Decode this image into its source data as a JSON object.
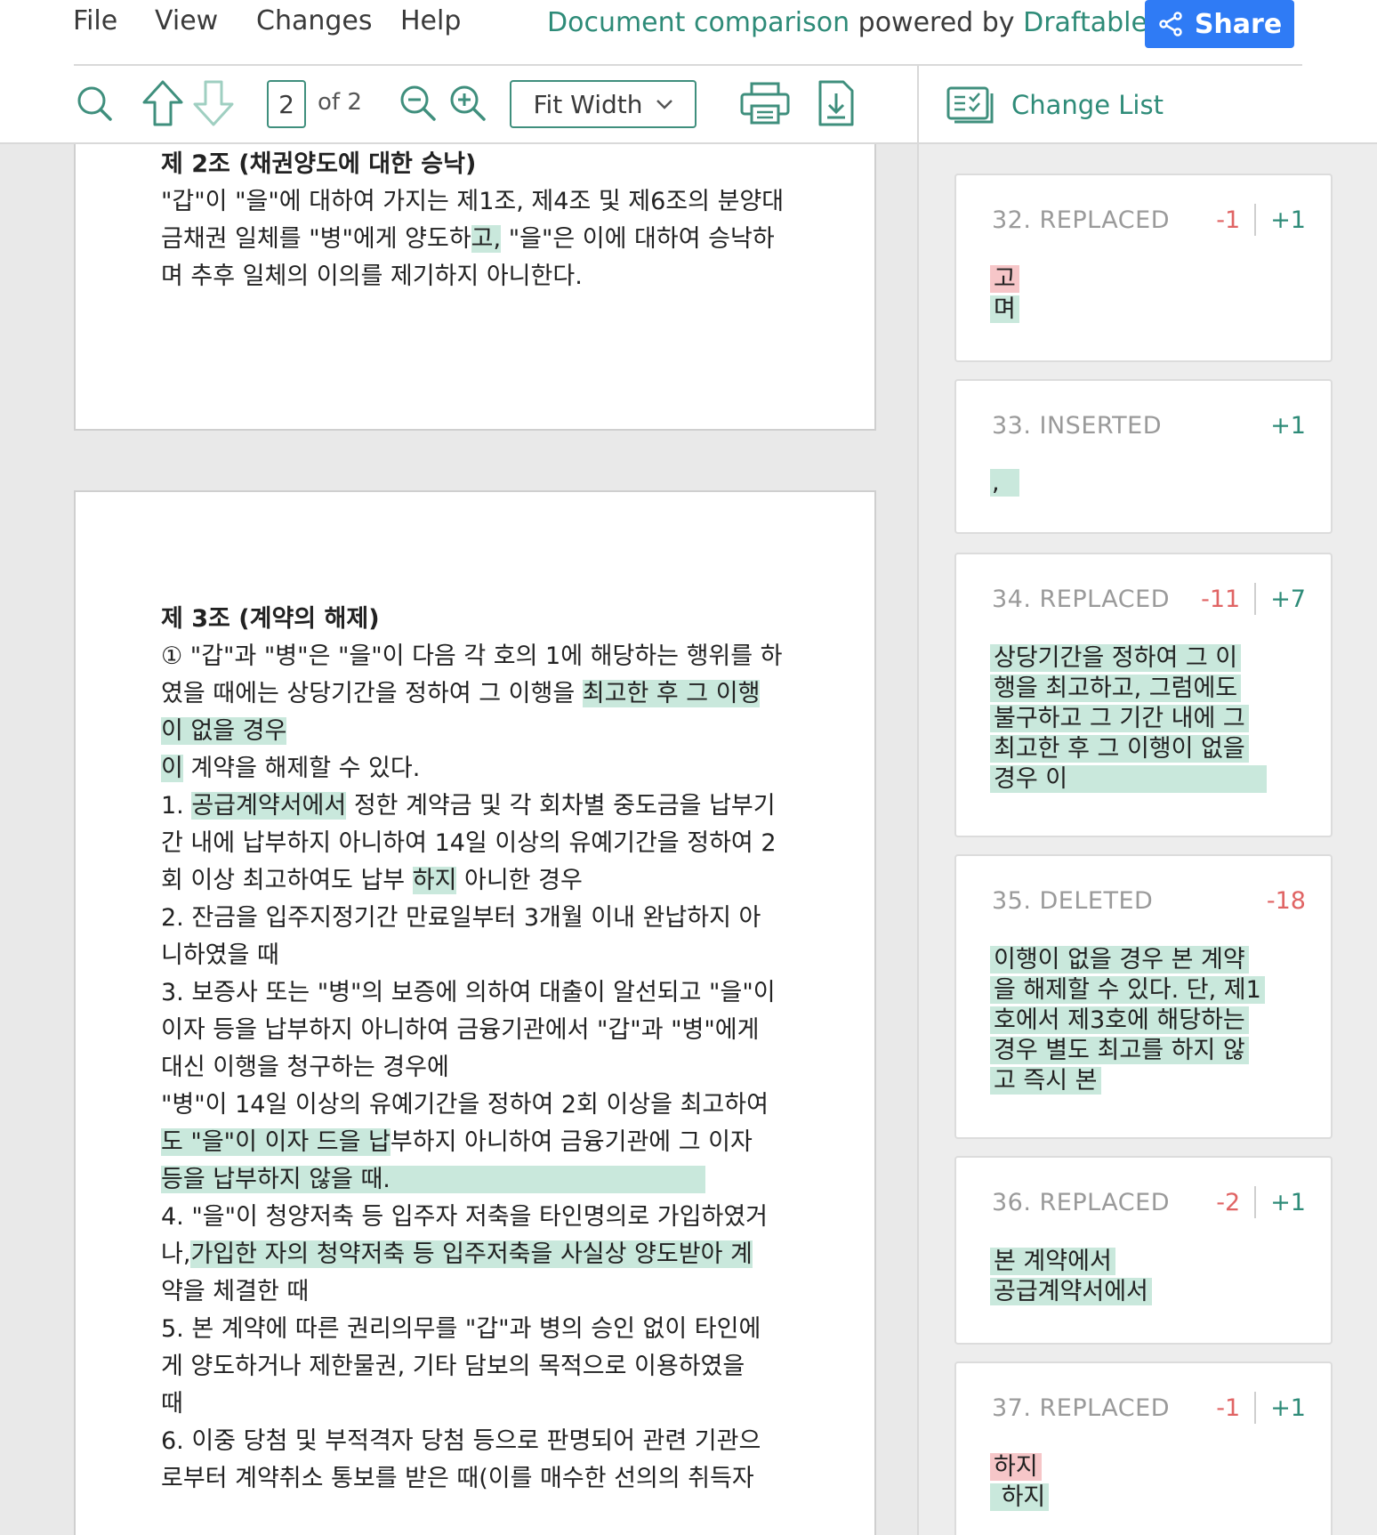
{
  "menu": {
    "items": [
      "File",
      "View",
      "Changes",
      "Help"
    ],
    "brand_prefix": "Document comparison",
    "brand_mid": " powered by ",
    "brand_name": "Draftable",
    "share_label": "Share"
  },
  "toolbar": {
    "current_page": "2",
    "of_pages": "of 2",
    "zoom_mode": "Fit Width"
  },
  "change_list": {
    "title": "Change List"
  },
  "doc": {
    "page1": {
      "heading": "제 2조 (채권양도에 대한 승낙)",
      "l1": "\"갑\"이 \"을\"에 대하여 가지는 제1조, 제4조 및 제6조의 분양대",
      "l2a": "금채권 일체를 \"병\"에게 양도하",
      "l2b": "고,",
      "l2c": " \"을\"은 이에 대하여 승낙하",
      "l3": "며 추후 일체의 이의를 제기하지 아니한다."
    },
    "page2": {
      "heading": "제 3조 (계약의 해제)",
      "l1": "① \"갑\"과 \"병\"은 \"을\"이 다음 각 호의 1에 해당하는 행위를 하",
      "l2a": "였을 때에는 상당기간을 정하여 그 이행을 ",
      "l2b": "최고한 후 그 이행",
      "l3": "이 없을 경우",
      "l4a": "이",
      "l4b": " 계약을 해제할 수 있다.",
      "l5a": "1. ",
      "l5b": "공급계약서에서",
      "l5c": " 정한 계약금 및 각 회차별 중도금을 납부기",
      "l6": "간 내에 납부하지 아니하여 14일 이상의 유예기간을 정하여 2",
      "l7a": "회 이상 최고하여도 납부 ",
      "l7b": "하지",
      "l7c": " 아니한 경우",
      "l8": "2. 잔금을 입주지정기간 만료일부터 3개월 이내 완납하지 아",
      "l9": "니하였을 때",
      "l10": "3. 보증사 또는 \"병\"의 보증에 의하여 대출이 알선되고 \"을\"이",
      "l11": "이자 등을 납부하지 아니하여 금융기관에서 \"갑\"과 \"병\"에게",
      "l12": "대신 이행을 청구하는 경우에",
      "l13": "\"병\"이 14일 이상의 유예기간을 정하여 2회 이상을 최고하여",
      "l14a": "도 \"을\"이 이자 드을 납",
      "l14b": "부하지 아니하여 금융기관에 그 이자",
      "l15": "등을 납부하지 않을 때.",
      "l16": "4. \"을\"이 청양저축 등 입주자 저축을 타인명의로 가입하였거",
      "l17a": "나,",
      "l17b": "가입한 자의 청약저축 등 입주저축을 사실상 양도받아 계",
      "l18": "약을 체결한 때",
      "l19": "5. 본 계약에 따른 권리의무를 \"갑\"과 병의 승인 없이 타인에",
      "l20": "게 양도하거나 제한물권, 기타 담보의 목적으로 이용하였을",
      "l21": "때",
      "l22": "6. 이중 당첨 및 부적격자 당첨 등으로 판명되어 관련 기관으",
      "l23": "로부터 계약취소 통보를 받은 때(이를 매수한 선의의 취득자"
    }
  },
  "changes": [
    {
      "label": "32. REPLACED",
      "del": "-1",
      "ins": "+1",
      "del_text": [
        "고"
      ],
      "ins_text": [
        "며"
      ]
    },
    {
      "label": "33. INSERTED",
      "del": "",
      "ins": "+1",
      "del_text": [],
      "ins_text": [
        ","
      ]
    },
    {
      "label": "34. REPLACED",
      "del": "-11",
      "ins": "+7",
      "del_text": [],
      "ins_text": [
        "상당기간을 정하여 그 이",
        "행을 최고하고, 그럼에도",
        "불구하고 그 기간 내에 그",
        "최고한 후 그 이행이 없을",
        "경우 이"
      ]
    },
    {
      "label": "35. DELETED",
      "del": "-18",
      "ins": "",
      "del_text": [],
      "ins_text": [
        "이행이 없을 경우 본 계약",
        "을 해제할 수 있다. 단, 제1",
        "호에서 제3호에 해당하는",
        "경우 별도 최고를 하지 않",
        "고 즉시 본"
      ]
    },
    {
      "label": "36. REPLACED",
      "del": "-2",
      "ins": "+1",
      "del_text": [],
      "ins_text": [
        "본 계약에서",
        "공급계약서에서"
      ]
    },
    {
      "label": "37. REPLACED",
      "del": "-1",
      "ins": "+1",
      "del_text": [
        "하지"
      ],
      "ins_text": [
        " 하지"
      ]
    }
  ],
  "colors": {
    "accent": "#2e8b78",
    "share": "#2f7bf5",
    "deleted": "#e06464",
    "insert_highlight": "#c9e8dc",
    "delete_highlight": "#f6c6c8"
  }
}
